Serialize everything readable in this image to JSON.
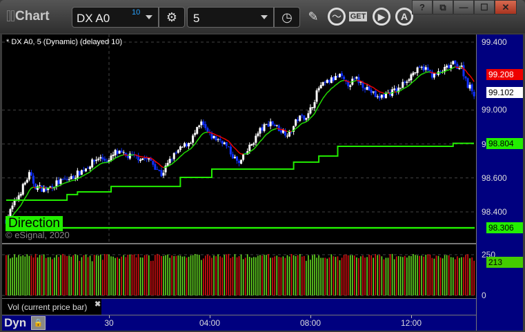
{
  "window": {
    "title": "Chart",
    "controls": [
      "?",
      "⧉",
      "—",
      "☐",
      "✕"
    ]
  },
  "toolbar": {
    "symbol": "DX A0",
    "symbol_badge": "10",
    "interval": "5",
    "icons": [
      "settings-gear-icon",
      "clock-icon",
      "pencil-icon",
      "study-icon",
      "get-icon",
      "play-icon",
      "alert-icon"
    ],
    "get_label": "GET"
  },
  "chart": {
    "legend": "* DX A0, 5 (Dynamic) (delayed 10)",
    "study_label": "Direction",
    "copyright": "© eSignal, 2020",
    "price_ticks": [
      "99.400",
      "99.000",
      "98.800",
      "98.600",
      "98.400"
    ],
    "price_tick_values": [
      99.4,
      99.0,
      98.8,
      98.6,
      98.4
    ],
    "tags": [
      {
        "value": "99.208",
        "bg": "#ee0000",
        "fg": "#ffffff"
      },
      {
        "value": "99.102",
        "bg": "#ffffff",
        "fg": "#000000"
      },
      {
        "value": "98.804",
        "bg": "#22ee00",
        "fg": "#000000"
      },
      {
        "value": "98.306",
        "bg": "#22ee00",
        "fg": "#000000"
      }
    ],
    "colors": {
      "up_candle": "#ffffff",
      "down_candle": "#1030ff",
      "ma_up": "#22dd00",
      "ma_down": "#ee0000",
      "level_line": "#22ee00",
      "axis_bg": "#00007f"
    }
  },
  "chart_data": {
    "type": "candlestick",
    "price_range": [
      98.28,
      99.44
    ],
    "close_path": [
      [
        "29 19:50",
        98.35
      ],
      [
        "29 20:05",
        98.43
      ],
      [
        "29 20:20",
        98.5
      ],
      [
        "29 20:45",
        98.62
      ],
      [
        "29 21:00",
        98.55
      ],
      [
        "29 21:25",
        98.53
      ],
      [
        "29 21:50",
        98.57
      ],
      [
        "29 22:25",
        98.6
      ],
      [
        "29 22:55",
        98.65
      ],
      [
        "29 23:30",
        98.72
      ],
      [
        "29 23:55",
        98.7
      ],
      [
        "30 00:10",
        98.75
      ],
      [
        "30 00:35",
        98.73
      ],
      [
        "30 01:10",
        98.72
      ],
      [
        "30 01:35",
        98.7
      ],
      [
        "30 02:00",
        98.62
      ],
      [
        "30 02:25",
        98.72
      ],
      [
        "30 02:50",
        98.78
      ],
      [
        "30 03:10",
        98.82
      ],
      [
        "30 03:35",
        98.92
      ],
      [
        "30 03:55",
        98.85
      ],
      [
        "30 04:10",
        98.83
      ],
      [
        "30 04:25",
        98.82
      ],
      [
        "30 04:50",
        98.73
      ],
      [
        "30 05:05",
        98.68
      ],
      [
        "30 05:30",
        98.78
      ],
      [
        "30 05:55",
        98.88
      ],
      [
        "30 06:20",
        98.93
      ],
      [
        "30 06:45",
        98.88
      ],
      [
        "30 07:05",
        98.86
      ],
      [
        "30 07:25",
        98.95
      ],
      [
        "30 07:50",
        98.97
      ],
      [
        "30 08:15",
        99.13
      ],
      [
        "30 08:40",
        99.17
      ],
      [
        "30 09:05",
        99.2
      ],
      [
        "30 09:20",
        99.15
      ],
      [
        "30 09:45",
        99.18
      ],
      [
        "30 10:10",
        99.13
      ],
      [
        "30 10:35",
        99.07
      ],
      [
        "30 11:00",
        99.1
      ],
      [
        "30 11:25",
        99.12
      ],
      [
        "30 11:40",
        99.17
      ],
      [
        "30 12:00",
        99.22
      ],
      [
        "30 12:25",
        99.25
      ],
      [
        "30 12:50",
        99.2
      ],
      [
        "30 13:10",
        99.23
      ],
      [
        "30 13:35",
        99.27
      ],
      [
        "30 13:55",
        99.25
      ],
      [
        "30 14:10",
        99.15
      ],
      [
        "30 14:25",
        99.1
      ]
    ],
    "direction_steps": [
      [
        "29 19:50",
        98.469
      ],
      [
        "29 22:15",
        98.502
      ],
      [
        "29 22:40",
        98.518
      ],
      [
        "30 00:00",
        98.55
      ],
      [
        "30 02:45",
        98.603
      ],
      [
        "30 04:00",
        98.652
      ],
      [
        "30 07:15",
        98.693
      ],
      [
        "30 08:15",
        98.729
      ],
      [
        "30 09:00",
        98.786
      ],
      [
        "30 13:35",
        98.804
      ]
    ],
    "direction_base": 98.306,
    "volume": {
      "label": "Vol (current price bar)",
      "ticks": [
        "250",
        "0"
      ],
      "last": "213",
      "last_value": 213,
      "range": [
        0,
        260
      ]
    },
    "time_ticks": [
      {
        "label": "30",
        "time": "30 00:00"
      },
      {
        "label": "04:00",
        "time": "30 04:00"
      },
      {
        "label": "08:00",
        "time": "30 08:00"
      },
      {
        "label": "12:00",
        "time": "30 12:00"
      }
    ]
  },
  "footer": {
    "mode": "Dyn"
  }
}
